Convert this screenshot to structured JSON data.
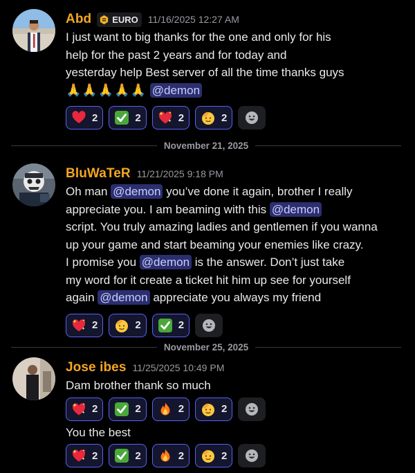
{
  "messages": [
    {
      "username": "Abd",
      "tag": "EURO",
      "timestamp": "11/16/2025 12:27 AM",
      "lines": [
        "I just want to big thanks for the one and only for his",
        "help for the  past 2 years and for today and",
        "yesterday help Best server of all the time thanks guys"
      ],
      "emoji_line": "🙏🙏🙏🙏🙏",
      "mention": "@demon",
      "reactions": [
        {
          "emoji": "heart-emoji",
          "count": "2"
        },
        {
          "emoji": "check-emoji",
          "count": "2"
        },
        {
          "emoji": "sparkle-heart-emoji",
          "count": "2"
        },
        {
          "emoji": "salute-emoji",
          "count": "2"
        }
      ]
    },
    {
      "username": "BluWaTeR",
      "timestamp": "11/21/2025 9:18 PM",
      "line1_a": "Oh man",
      "line1_m": "@demon",
      "line1_b": "you’ve done it again, brother I really",
      "line2_a": "appreciate you. I am beaming with this",
      "line2_m": "@demon",
      "line3": "script. You truly amazing ladies and gentlemen if you wanna",
      "line4": "up your game and start beaming your enemies like crazy.",
      "line5_a": "I promise you",
      "line5_m": "@demon",
      "line5_b": "is the answer. Don’t just take",
      "line6": "my word for it create a ticket hit him up see for yourself",
      "line7_a": "again",
      "line7_m": "@demon",
      "line7_b": "appreciate you always my friend",
      "reactions": [
        {
          "emoji": "sparkle-heart-emoji",
          "count": "2"
        },
        {
          "emoji": "salute-emoji",
          "count": "2"
        },
        {
          "emoji": "check-emoji",
          "count": "2"
        }
      ]
    },
    {
      "username": "Jose ibes",
      "timestamp": "11/25/2025 10:49 PM",
      "text1": "Dam brother thank so much",
      "text2": "You the best",
      "reactions": [
        {
          "emoji": "sparkle-heart-emoji",
          "count": "2"
        },
        {
          "emoji": "check-emoji",
          "count": "2"
        },
        {
          "emoji": "fire-emoji",
          "count": "2"
        },
        {
          "emoji": "salute-emoji",
          "count": "2"
        }
      ]
    }
  ],
  "dividers": [
    "November 21, 2025",
    "November 25, 2025"
  ],
  "colors": {
    "username": "#f5a623",
    "mention_bg": "#2b2f6e",
    "reaction_border": "#5865f2"
  }
}
